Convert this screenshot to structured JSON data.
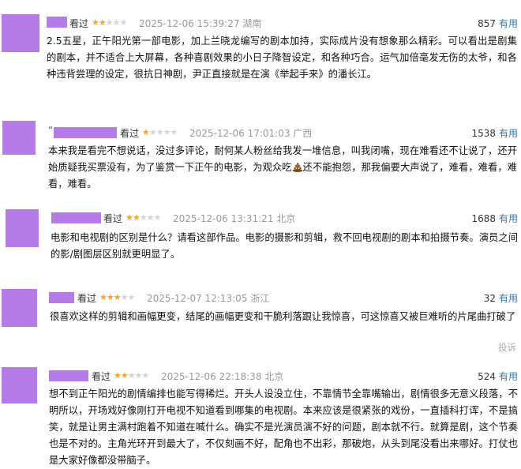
{
  "reviews": [
    {
      "seen_label": "看过",
      "rating": 2,
      "time": "2025-12-06 15:39:27",
      "location": "湖南",
      "votes": "857",
      "helpful_label": "有用",
      "content": "2.5五星，正午阳光第一部电影，加上兰晓龙编写的剧本加持，实际成片没有想象那么精彩。可以看出是剧集的剧本，并不适合上大屏幕，各种喜剧效果的小日子降智设定，和各种巧合。运气加倍毫发无伤的太爷，和各种违背尝理的设定，很抗日神剧，尹正直接就是在演《举起手来》的潘长江。"
    },
    {
      "name_prefix": "“",
      "seen_label": "看过",
      "rating": 1,
      "time": "2025-12-06 17:01:03",
      "location": "广西",
      "votes": "1538",
      "helpful_label": "有用",
      "content_before": "本来我是看完不想说话，没过多评论，耐何某人粉丝给我发一堆信息，叫我闭嘴，现在难看还不让说了，还开始质疑我买票没有，为了鉴赏一下正午的电影，为观众吃",
      "emoji_name": "poop-emoji",
      "content_after": "还不能抱怨，那我偏要大声说了，难看，难看，难看，难看。"
    },
    {
      "seen_label": "看过",
      "rating": 2,
      "time": "2025-12-06 13:31:21",
      "location": "北京",
      "votes": "1688",
      "helpful_label": "有用",
      "content": "电影和电视剧的区别是什么？请看这部作品。电影的摄影和剪辑，救不回电视剧的剧本和拍摄节奏。演员之间的影/剧图层区别就更明显了。"
    },
    {
      "seen_label": "看过",
      "rating": 3,
      "time": "2025-12-07 12:13:05",
      "location": "浙江",
      "votes": "32",
      "helpful_label": "有用",
      "content": "很喜欢这样的剪辑和画幅更变，结尾的画幅更变和干脆利落跟让我惊喜，可这惊喜又被巨难听的片尾曲打破了",
      "report_label": "投诉"
    },
    {
      "seen_label": "看过",
      "rating": 2,
      "time": "2025-12-06 22:18:38",
      "location": "北京",
      "votes": "524",
      "helpful_label": "有用",
      "content": "想不到正午阳光的剧情编排也能写得稀烂。开头人设没立住，不靠情节全靠嘴输出，剧情很多无意义段落，不明所以，开场戏好像刚打开电视不知道看到哪集的电视剧。本来应该是很紧张的戏份，一直插科打诨，不是搞笑，就是让男主满村跑着不知道在喊什么。确实不是光演员演不好的问题，剧本就不行。就算是剧，这个节奏也是不对的。主角光环开到最大了，不仅刻画不好，配角也不出彩，那破炮，从头到尾没看出来哪好。打仗也是大家好像都没带脑子。"
    }
  ],
  "colors": {
    "accent": "#3377aa",
    "star": "#f5a623",
    "avatar_placeholder": "#b57be6"
  }
}
